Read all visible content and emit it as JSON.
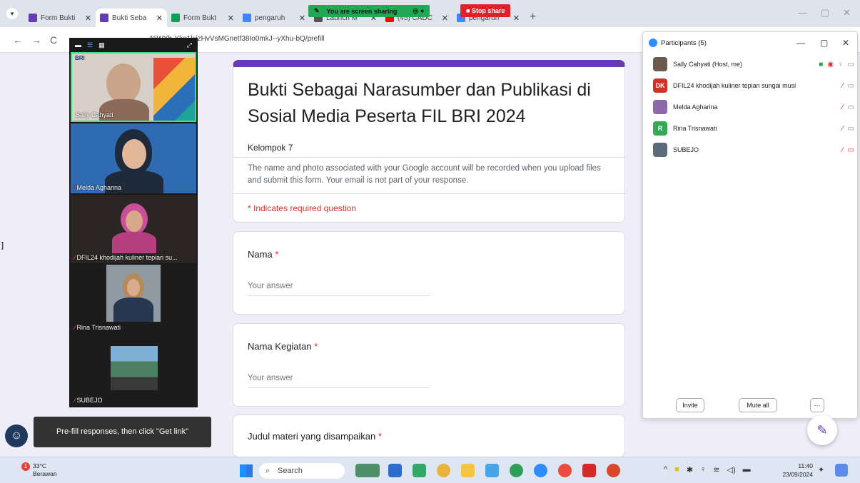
{
  "browser": {
    "tabs": [
      {
        "title": "Form Bukti",
        "favicon_color": "#673ab7",
        "favicon_glyph": "form-icon",
        "active": false
      },
      {
        "title": "Bukti Seba",
        "favicon_color": "#673ab7",
        "favicon_glyph": "form-icon",
        "active": true
      },
      {
        "title": "Form Bukt",
        "favicon_color": "#0f9d58",
        "favicon_glyph": "sheets-icon",
        "active": false
      },
      {
        "title": "pengaruh",
        "favicon_color": "#4285f4",
        "favicon_glyph": "google-icon",
        "active": false
      },
      {
        "title": "Launch M",
        "favicon_color": "#555555",
        "favicon_glyph": "globe-icon",
        "active": false
      },
      {
        "title": "(45) CADC",
        "favicon_color": "#ff0000",
        "favicon_glyph": "youtube-icon",
        "active": false
      },
      {
        "title": "pengaruh",
        "favicon_color": "#4285f4",
        "favicon_glyph": "google-icon",
        "active": false
      }
    ],
    "url": "NjWYb-Yko1lxizHvVsMGnetf38Io0mkJ--yXhu-bQ/prefill"
  },
  "sharing": {
    "banner_text": "You are screen sharing",
    "stop_label": "Stop share"
  },
  "form": {
    "title": "Bukti Sebagai Narasumber dan Publikasi di Sosial Media Peserta FIL BRI 2024",
    "section": "Kelompok 7",
    "note": "The name and photo associated with your Google account will be recorded when you upload files and submit this form. Your email is not part of your response.",
    "required_note": "* Indicates required question",
    "questions": [
      {
        "label": "Nama",
        "required_mark": "*",
        "placeholder": "Your answer"
      },
      {
        "label": "Nama Kegiatan",
        "required_mark": "*",
        "placeholder": "Your answer"
      },
      {
        "label": "Judul materi yang disampaikan",
        "required_mark": "*"
      }
    ]
  },
  "video": {
    "tiles": [
      {
        "name": "Sally Cahyati",
        "muted": false,
        "logo_text": "BRI"
      },
      {
        "name": "Melda Agharina",
        "muted": true
      },
      {
        "name": "DFIL24 khodijah kuliner tepian su...",
        "muted": true
      },
      {
        "name": "Rina Trisnawati",
        "muted": true
      },
      {
        "name": "SUBEJO",
        "muted": true
      }
    ]
  },
  "participants": {
    "title": "Participants (5)",
    "rows": [
      {
        "name": "Sally Cahyati (Host, me)",
        "avatar_text": "",
        "avatar_color": "#6b5a4e"
      },
      {
        "name": "DFIL24 khodijah kuliner tepian sungai musi",
        "avatar_text": "DK",
        "avatar_color": "#d93025"
      },
      {
        "name": "Melda Agharina",
        "avatar_text": "",
        "avatar_color": "#8a6aa8"
      },
      {
        "name": "Rina Trisnawati",
        "avatar_text": "R",
        "avatar_color": "#34a853"
      },
      {
        "name": "SUBEJO",
        "avatar_text": "",
        "avatar_color": "#5b6b7a"
      }
    ],
    "invite_label": "Invite",
    "mute_all_label": "Mute all",
    "more_label": "···"
  },
  "toast": "Pre-fill responses, then click \"Get link\"",
  "taskbar": {
    "temperature": "33°C",
    "weather": "Berawan",
    "search_label": "Search",
    "time": "11:40",
    "date": "23/09/2024"
  }
}
